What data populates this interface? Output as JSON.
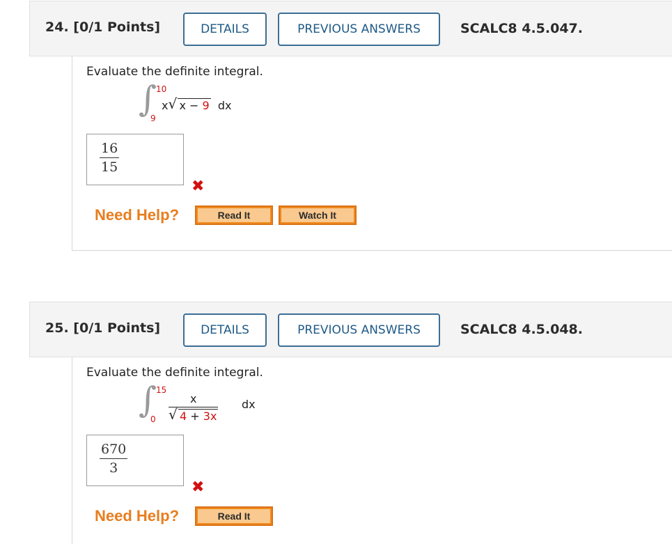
{
  "questions": [
    {
      "number_label": "24.",
      "points_label": "[0/1 Points]",
      "details_label": "DETAILS",
      "previous_answers_label": "PREVIOUS ANSWERS",
      "code": "SCALC8 4.5.047.",
      "prompt": "Evaluate the definite integral.",
      "integral": {
        "upper_limit": "10",
        "lower_limit": "9",
        "integrand_prefix": "x",
        "radicand_var": "x − ",
        "radicand_const": "9",
        "differential": "dx"
      },
      "answer": {
        "numerator": "16",
        "denominator": "15",
        "status_icon": "x-mark-icon",
        "correct": false
      },
      "need_help_label": "Need Help?",
      "help_buttons": [
        "Read It",
        "Watch It"
      ]
    },
    {
      "number_label": "25.",
      "points_label": "[0/1 Points]",
      "details_label": "DETAILS",
      "previous_answers_label": "PREVIOUS ANSWERS",
      "code": "SCALC8 4.5.048.",
      "prompt": "Evaluate the definite integral.",
      "integral": {
        "upper_limit": "15",
        "lower_limit": "0",
        "numerator": "x",
        "radicand_const": "4",
        "radicand_op": " + ",
        "radicand_term": "3x",
        "differential": "dx"
      },
      "answer": {
        "numerator": "670",
        "denominator": "3",
        "status_icon": "x-mark-icon",
        "correct": false
      },
      "need_help_label": "Need Help?",
      "help_buttons": [
        "Read It"
      ]
    }
  ],
  "colors": {
    "header_bg": "#f4f4f4",
    "button_border": "#3b6e96",
    "button_text": "#1f5a86",
    "limit_red": "#d11010",
    "need_help_orange": "#e87d1e",
    "help_button_orange": "#f28a1c"
  }
}
